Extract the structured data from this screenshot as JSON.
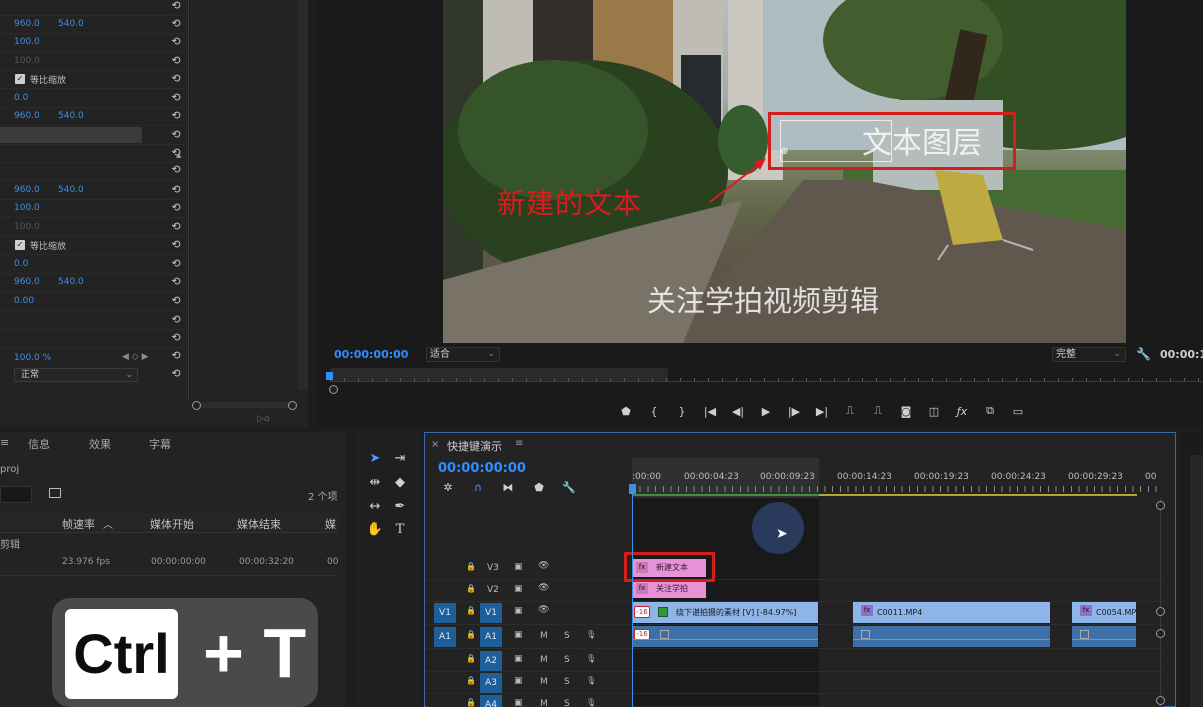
{
  "effect_controls": {
    "rows": [
      {
        "a": "960.0",
        "b": "540.0"
      },
      {
        "a": "100.0"
      },
      {
        "a": "100.0",
        "dim": true
      },
      {
        "check_label": "等比缩放"
      },
      {
        "a": "0.0"
      },
      {
        "a": "960.0",
        "b": "540.0"
      },
      {
        "a": ""
      },
      {
        "a": ""
      },
      {
        "a": ""
      },
      {
        "a": "960.0",
        "b": "540.0"
      },
      {
        "a": "100.0"
      },
      {
        "a": "100.0",
        "dim": true
      },
      {
        "check_label": "等比缩放"
      },
      {
        "a": "0.0"
      },
      {
        "a": "960.0",
        "b": "540.0"
      },
      {
        "a": "0.00"
      }
    ],
    "opacity": "100.0 %",
    "blend_mode": "正常"
  },
  "program_monitor": {
    "video_text": {
      "new_text": "新建的文本",
      "text_layer": "文本图层",
      "follow": "关注学拍视频剪辑"
    },
    "timecode": "00:00:00:00",
    "fit": "适合",
    "quality": "完整",
    "end_timecode": "00:00:1"
  },
  "project_panel": {
    "tabs": [
      "信息",
      "效果",
      "字幕"
    ],
    "name": "proj",
    "item_count": "2 个项",
    "columns": [
      "帧速率",
      "媒体开始",
      "媒体结束",
      "媒"
    ],
    "row_label": "剪辑",
    "row": {
      "fps": "23.976 fps",
      "start": "00:00:00:00",
      "end": "00:00:32:20",
      "extra": "00"
    }
  },
  "shortcut_overlay": {
    "key": "Ctrl",
    "combo": "+ T"
  },
  "timeline": {
    "tab_name": "快捷键演示",
    "timecode": "00:00:00:00",
    "ruler": [
      ":00:00",
      "00:00:04:23",
      "00:00:09:23",
      "00:00:14:23",
      "00:00:19:23",
      "00:00:24:23",
      "00:00:29:23",
      "00"
    ],
    "tracks": {
      "v3": "V3",
      "v2": "V2",
      "v1": "V1",
      "a1": "A1",
      "a2": "A2",
      "a3": "A3",
      "a4": "A4",
      "src_v1": "V1",
      "src_a1": "A1",
      "mute": "M",
      "solo": "S"
    },
    "clips": {
      "graphic_new": "新建文本",
      "graphic_follow": "关注学拍",
      "main_clip": "绕下谌拍摄的素材 [V] [-84.97%]",
      "c0011": "C0011.MP4",
      "c0054": "C0054.MP",
      "speed_badge": "-16",
      "fx": "fx"
    }
  }
}
